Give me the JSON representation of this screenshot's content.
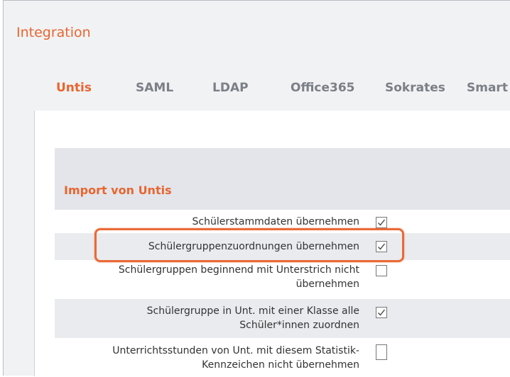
{
  "window": {
    "title": "Integration"
  },
  "tabs": [
    {
      "label": "Untis",
      "active": true
    },
    {
      "label": "SAML",
      "active": false
    },
    {
      "label": "LDAP",
      "active": false
    },
    {
      "label": "Office365",
      "active": false
    },
    {
      "label": "Sokrates",
      "active": false
    },
    {
      "label": "Smart",
      "active": false
    }
  ],
  "section": {
    "title": "Import von Untis"
  },
  "settings": [
    {
      "label": "Schülerstammdaten übernehmen",
      "checked": true
    },
    {
      "label": "Schülergruppenzuordnungen übernehmen",
      "checked": true
    },
    {
      "label_line1": "Schülergruppen beginnend mit Unterstrich nicht",
      "label_line2": "übernehmen",
      "checked": false
    },
    {
      "label_line1": "Schülergruppe in Unt. mit einer Klasse alle",
      "label_line2": "Schüler*innen zuordnen",
      "checked": true
    },
    {
      "label_line1": "Unterrichtsstunden von Unt. mit diesem Statistik-",
      "label_line2": "Kennzeichen nicht übernehmen",
      "checked": false
    }
  ],
  "colors": {
    "accent": "#e8652f",
    "tab_inactive": "#7b7f86",
    "row_alt": "#e9ebef",
    "section_head": "#e3e5ea"
  }
}
